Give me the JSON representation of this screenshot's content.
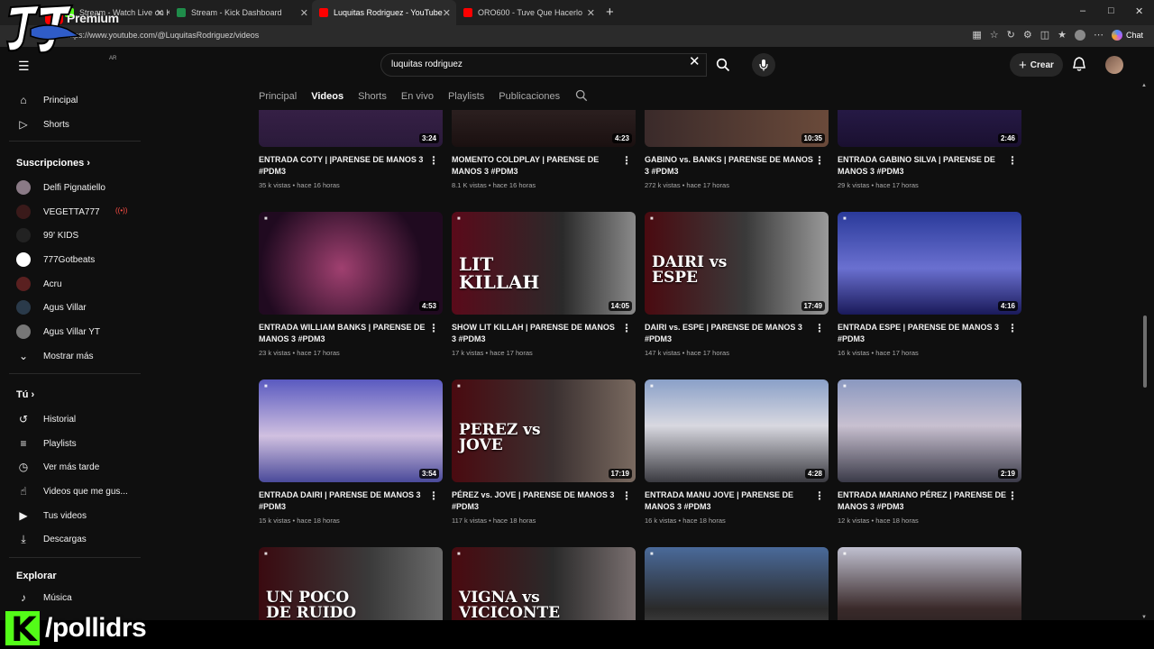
{
  "browser": {
    "tabs": [
      {
        "label": "Stream - Watch Live on Kick",
        "color": "#53fc18"
      },
      {
        "label": "Stream - Kick Dashboard",
        "color": "#1f8c4a"
      },
      {
        "label": "Luquitas Rodriguez - YouTube",
        "color": "#ff0000",
        "active": true
      },
      {
        "label": "ORO600 - Tuve Que Hacerlo",
        "color": "#ff0000"
      }
    ],
    "url": "https://www.youtube.com/@LuquitasRodriguez/videos",
    "chat_label": "Chat"
  },
  "youtube": {
    "logo_text": "Premium",
    "country": "AR",
    "search_value": "luquitas rodriguez",
    "create_label": "Crear"
  },
  "channel_tabs": [
    "Principal",
    "Videos",
    "Shorts",
    "En vivo",
    "Playlists",
    "Publicaciones"
  ],
  "sidebar": {
    "main": [
      {
        "label": "Principal",
        "icon": "home-icon"
      },
      {
        "label": "Shorts",
        "icon": "shorts-icon"
      }
    ],
    "subscriptions_title": "Suscripciones",
    "subscriptions": [
      {
        "label": "Delfi Pignatiello",
        "color": "#8a7a86"
      },
      {
        "label": "VEGETTA777",
        "color": "#3a1a1a",
        "live": true
      },
      {
        "label": "99' KIDS",
        "color": "#222222"
      },
      {
        "label": "777Gotbeats",
        "color": "#ffffff"
      },
      {
        "label": "Acru",
        "color": "#5a2020"
      },
      {
        "label": "Agus Villar",
        "color": "#2a3a4a"
      },
      {
        "label": "Agus Villar YT",
        "color": "#777777"
      }
    ],
    "show_more": "Mostrar más",
    "you_title": "Tú",
    "you_items": [
      {
        "label": "Historial",
        "icon": "history-icon"
      },
      {
        "label": "Playlists",
        "icon": "playlists-icon"
      },
      {
        "label": "Ver más tarde",
        "icon": "watch-later-icon"
      },
      {
        "label": "Videos que me gus...",
        "icon": "like-icon"
      },
      {
        "label": "Tus videos",
        "icon": "your-videos-icon"
      },
      {
        "label": "Descargas",
        "icon": "download-icon"
      }
    ],
    "explore_title": "Explorar",
    "explore_items": [
      {
        "label": "Música",
        "icon": "music-icon"
      }
    ]
  },
  "videos": [
    {
      "title": "ENTRADA COTY | |PARENSE DE MANOS 3 #PDM3",
      "views": "35 k vistas",
      "age": "hace 16 horas",
      "duration": "3:24",
      "bg": "linear-gradient(180deg,#4a2a5a,#2a1a3a)",
      "big": ""
    },
    {
      "title": "MOMENTO COLDPLAY | PARENSE DE MANOS 3 #PDM3",
      "views": "8.1 K vistas",
      "age": "hace 16 horas",
      "duration": "4:23",
      "bg": "linear-gradient(180deg,#4a3a3a,#1a1010)",
      "big": ""
    },
    {
      "title": "GABINO vs. BANKS | PARENSE DE MANOS 3 #PDM3",
      "views": "272 k vistas",
      "age": "hace 17 horas",
      "duration": "10:35",
      "bg": "linear-gradient(90deg,#3a2a2a,#6a4a3a)",
      "big": ""
    },
    {
      "title": "ENTRADA GABINO SILVA | PARENSE DE MANOS 3 #PDM3",
      "views": "29 k vistas",
      "age": "hace 17 horas",
      "duration": "2:46",
      "bg": "linear-gradient(180deg,#3a2a6a,#1a1030)",
      "big": ""
    },
    {
      "title": "ENTRADA WILLIAM BANKS | PARENSE DE MANOS 3 #PDM3",
      "views": "23 k vistas",
      "age": "hace 17 horas",
      "duration": "4:53",
      "bg": "radial-gradient(circle at 45% 55%,#a04070,#200a20 70%)",
      "big": ""
    },
    {
      "title": "SHOW LIT KILLAH | PARENSE DE MANOS 3 #PDM3",
      "views": "17 k vistas",
      "age": "hace 17 horas",
      "duration": "14:05",
      "bg": "linear-gradient(90deg,#5a0a1a,#2a2a2a 60%,#8a8a8a)",
      "big": "LIT KILLAH"
    },
    {
      "title": "DAIRI vs. ESPE | PARENSE DE MANOS 3 #PDM3",
      "views": "147 k vistas",
      "age": "hace 17 horas",
      "duration": "17:49",
      "bg": "linear-gradient(90deg,#4a0a10,#3a3a3a 55%,#9a9a9a)",
      "big": "DAIRI vs ESPE"
    },
    {
      "title": "ENTRADA ESPE | PARENSE DE MANOS 3 #PDM3",
      "views": "16 k vistas",
      "age": "hace 17 horas",
      "duration": "4:16",
      "bg": "linear-gradient(180deg,#2a3a9a,#6a70d0 55%,#1a1a5a)",
      "big": ""
    },
    {
      "title": "ENTRADA DAIRI | PARENSE DE MANOS 3 #PDM3",
      "views": "15 k vistas",
      "age": "hace 18 horas",
      "duration": "3:54",
      "bg": "linear-gradient(180deg,#5a5ac0,#d0c0e0 55%,#4a4a9a)",
      "big": ""
    },
    {
      "title": "PÉREZ vs. JOVE | PARENSE DE MANOS 3 #PDM3",
      "views": "117 k vistas",
      "age": "hace 18 horas",
      "duration": "17:19",
      "bg": "linear-gradient(90deg,#4a0a10,#3a3030 55%,#7a6a60)",
      "big": "PEREZ vs JOVE"
    },
    {
      "title": "ENTRADA MANU JOVE | PARENSE DE MANOS 3 #PDM3",
      "views": "16 k vistas",
      "age": "hace 18 horas",
      "duration": "4:28",
      "bg": "linear-gradient(180deg,#8aa0c8,#d8d8e0 45%,#3a3a40)",
      "big": ""
    },
    {
      "title": "ENTRADA MARIANO PÉREZ | PARENSE DE MANOS 3 #PDM3",
      "views": "12 k vistas",
      "age": "hace 18 horas",
      "duration": "2:19",
      "bg": "linear-gradient(180deg,#8a98c0,#c8c0d0 45%,#3a3a48)",
      "big": ""
    },
    {
      "title": "",
      "views": "",
      "age": "",
      "duration": "",
      "bg": "linear-gradient(90deg,#3a0a10,#3a3a3a 60%,#6a6a6a)",
      "big": "UN POCO DE RUIDO"
    },
    {
      "title": "",
      "views": "",
      "age": "",
      "duration": "",
      "bg": "linear-gradient(90deg,#4a0a10,#2a2a2a 55%,#7a7070)",
      "big": "VIGNA vs VICICONTE"
    },
    {
      "title": "",
      "views": "",
      "age": "",
      "duration": "",
      "bg": "linear-gradient(180deg,#4a6a9a,#2a2a2a 60%,#5a5a5a)",
      "big": ""
    },
    {
      "title": "",
      "views": "",
      "age": "",
      "duration": "",
      "bg": "linear-gradient(180deg,#c0c0d0,#3a2a2a 60%,#1a1a1a)",
      "big": ""
    }
  ],
  "overlay": {
    "handle": "/pollidrs"
  }
}
